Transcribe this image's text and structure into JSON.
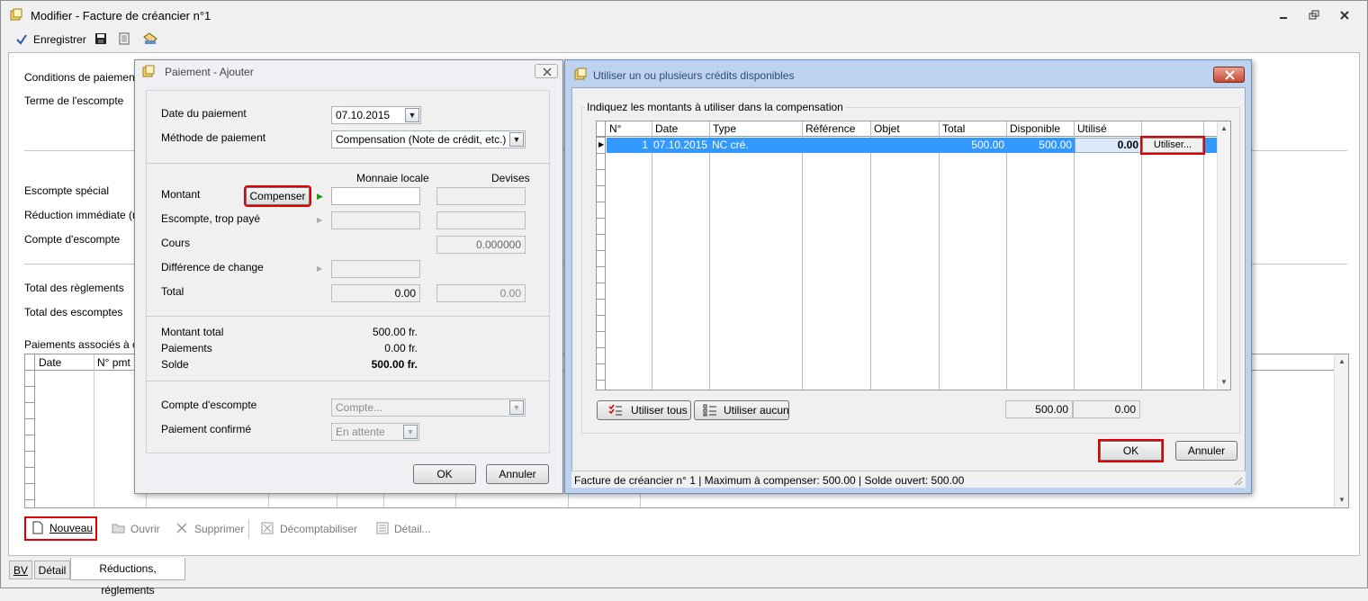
{
  "window": {
    "title": "Modifier - Facture de créancier n°1",
    "save_label": "Enregistrer",
    "save_mnemonic": "E"
  },
  "main_form": {
    "conditions_label": "Conditions de paiement",
    "terme_label": "Terme de l'escompte",
    "escompte_special_label": "Escompte spécial",
    "reduction_label": "Réduction immédiate (rem",
    "compte_escompte_label": "Compte d'escompte",
    "total_reglements_label": "Total des règlements",
    "total_escomptes_label": "Total des escomptes",
    "paiements_associes_label": "Paiements associés à ce c",
    "grid_cols": [
      "Date",
      "N° pmt"
    ]
  },
  "bottom_toolbar": {
    "nouveau": "Nouveau",
    "ouvrir": "Ouvrir",
    "supprimer": "Supprimer",
    "decomptabiliser": "Décomptabiliser",
    "detail": "Détail..."
  },
  "tabs": [
    "BV",
    "Détail",
    "Réductions, réglements"
  ],
  "paiement_dialog": {
    "title": "Paiement - Ajouter",
    "date_label": "Date du paiement",
    "date_value": "07.10.2015",
    "methode_label": "Méthode de paiement",
    "methode_value": "Compensation (Note de crédit, etc.)",
    "col_local": "Monnaie locale",
    "col_devises": "Devises",
    "montant_label": "Montant",
    "compenser_label": "Compenser",
    "escompte_label": "Escompte, trop payé",
    "cours_label": "Cours",
    "cours_value": "0.000000",
    "difference_label": "Différence de change",
    "total_label": "Total",
    "total_local": "0.00",
    "total_devises": "0.00",
    "montant_total_label": "Montant total",
    "montant_total_value": "500.00 fr.",
    "paiements_label": "Paiements",
    "paiements_value": "0.00 fr.",
    "solde_label": "Solde",
    "solde_value": "500.00 fr.",
    "compte_escompte_label": "Compte d'escompte",
    "compte_placeholder": "Compte...",
    "confirme_label": "Paiement confirmé",
    "confirme_value": "En attente",
    "ok": "OK",
    "annuler": "Annuler"
  },
  "credits_dialog": {
    "title": "Utiliser un ou plusieurs crédits disponibles",
    "group_label": "Indiquez les montants à utiliser dans la compensation",
    "columns": [
      "N°",
      "Date",
      "Type",
      "Référence",
      "Objet",
      "Total",
      "Disponible",
      "Utilisé"
    ],
    "rows": [
      {
        "no": "1",
        "date": "07.10.2015",
        "type": "NC cré.",
        "reference": "",
        "objet": "",
        "total": "500.00",
        "disponible": "500.00",
        "utilise": "0.00",
        "button": "Utiliser..."
      }
    ],
    "utiliser_tous": "Utiliser tous",
    "utiliser_aucun": "Utiliser aucun",
    "sum_disponible": "500.00",
    "sum_utilise": "0.00",
    "ok": "OK",
    "annuler": "Annuler",
    "status": "Facture de créancier n° 1 | Maximum à compenser: 500.00 | Solde ouvert: 500.00"
  },
  "colors": {
    "selection": "#3399ff",
    "highlight_border": "#e00000",
    "credit_title_bg": "#bcd2ee"
  }
}
